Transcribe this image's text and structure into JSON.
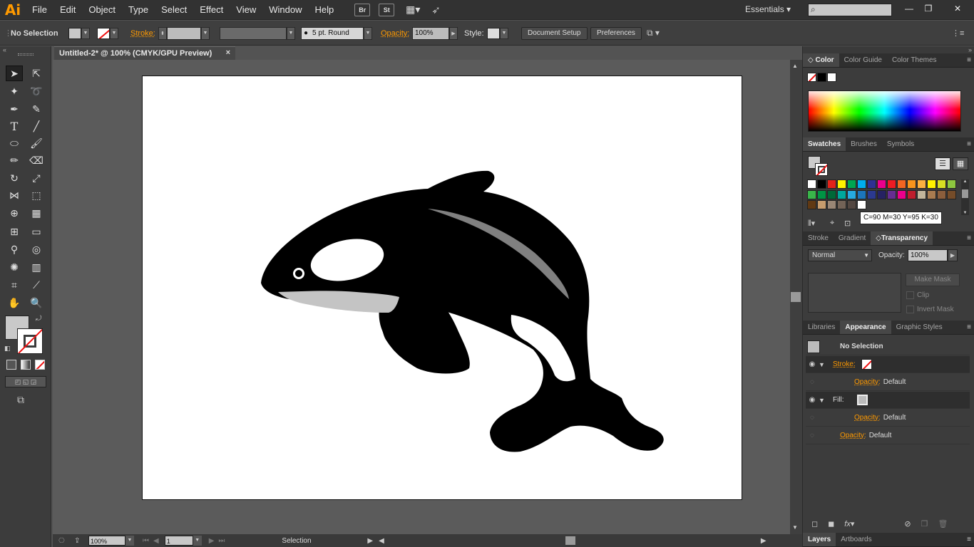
{
  "app": {
    "logo": "Ai"
  },
  "menu": [
    "File",
    "Edit",
    "Object",
    "Type",
    "Select",
    "Effect",
    "View",
    "Window",
    "Help"
  ],
  "menu_buttons": [
    "Br",
    "St"
  ],
  "workspace": "Essentials",
  "control": {
    "selection": "No Selection",
    "stroke_label": "Stroke:",
    "brush": "5 pt. Round",
    "opacity_label": "Opacity:",
    "opacity_value": "100%",
    "style_label": "Style:",
    "doc_setup": "Document Setup",
    "preferences": "Preferences"
  },
  "document": {
    "tab_title": "Untitled-2* @ 100% (CMYK/GPU Preview)",
    "close": "×"
  },
  "status": {
    "zoom": "100%",
    "page": "1",
    "tool": "Selection"
  },
  "color_panel": {
    "tabs": [
      "Color",
      "Color Guide",
      "Color Themes"
    ]
  },
  "swatches_panel": {
    "tabs": [
      "Swatches",
      "Brushes",
      "Symbols"
    ],
    "tooltip": "C=90 M=30 Y=95 K=30",
    "colors": [
      "#ffffff",
      "#000000",
      "#e2231a",
      "#fff200",
      "#00a651",
      "#00aeef",
      "#2e3192",
      "#ec008c",
      "#ed1c24",
      "#f26522",
      "#f7941d",
      "#fbb040",
      "#fff200",
      "#d7df23",
      "#8dc63f",
      "#39b54a",
      "#009444",
      "#006838",
      "#00a79d",
      "#27aae1",
      "#1c75bc",
      "#2b3990",
      "#262262",
      "#662d91",
      "#ec008c",
      "#be1e2d",
      "#c2b59b",
      "#a97c50",
      "#8b5e3c",
      "#754c29",
      "#603913",
      "#c69c6d",
      "#998675",
      "#736357",
      "#534741",
      "#ffffff"
    ]
  },
  "transparency_panel": {
    "tabs": [
      "Stroke",
      "Gradient",
      "Transparency"
    ],
    "blend": "Normal",
    "opacity_label": "Opacity:",
    "opacity_value": "100%",
    "make_mask": "Make Mask",
    "clip": "Clip",
    "invert_mask": "Invert Mask"
  },
  "appearance_panel": {
    "tabs": [
      "Libraries",
      "Appearance",
      "Graphic Styles"
    ],
    "header": "No Selection",
    "stroke_label": "Stroke:",
    "fill_label": "Fill:",
    "opacity_label": "Opacity:",
    "opacity_default": "Default"
  },
  "bottom_tabs": [
    "Layers",
    "Artboards"
  ]
}
